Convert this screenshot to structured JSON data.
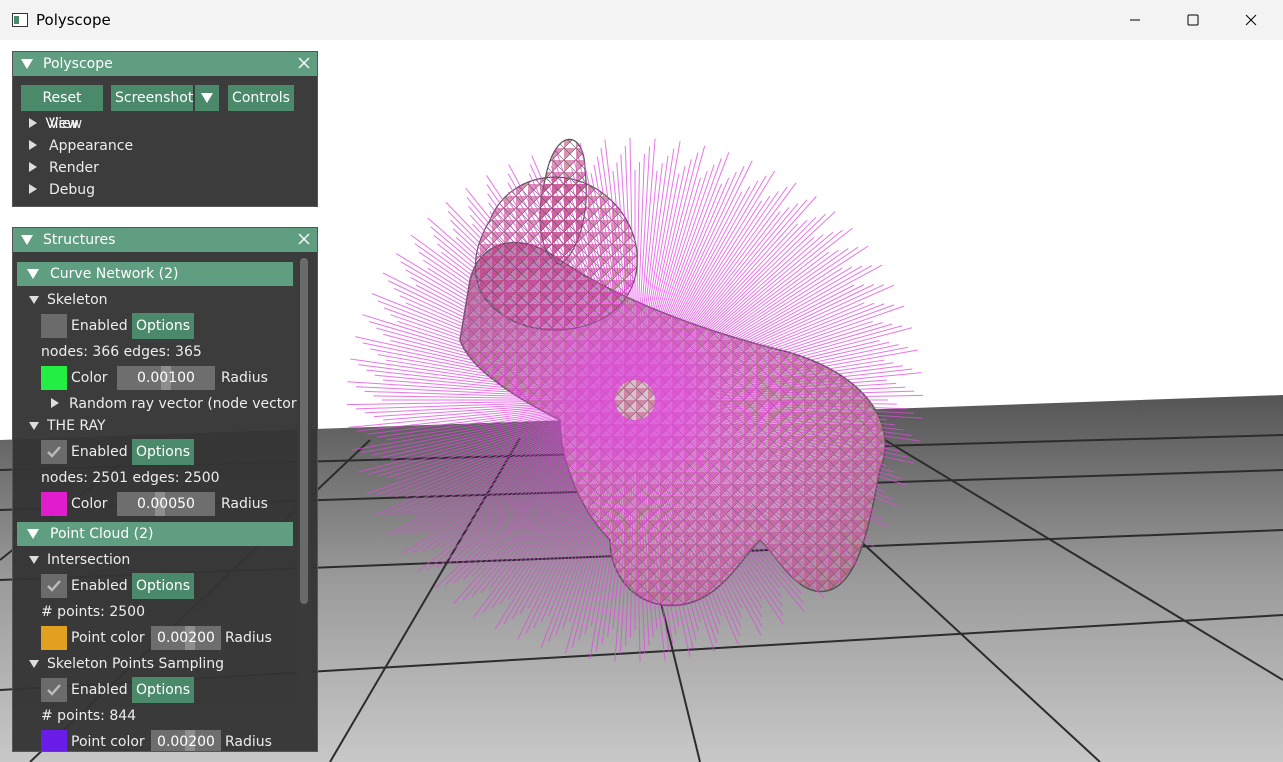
{
  "window": {
    "title": "Polyscope",
    "minimize_icon": "minimize-icon",
    "maximize_icon": "maximize-icon",
    "close_icon": "close-icon"
  },
  "colors": {
    "accent": "#5f9e80",
    "button": "#4a8a6a",
    "panel_bg": "#343434",
    "ray": "#e048e0"
  },
  "polyscope_panel": {
    "title": "Polyscope",
    "buttons": {
      "reset_view": "Reset View",
      "screenshot": "Screenshot",
      "controls": "Controls"
    },
    "menu": [
      "View",
      "Appearance",
      "Render",
      "Debug"
    ]
  },
  "structures_panel": {
    "title": "Structures",
    "curve_network": {
      "header": "Curve Network (2)",
      "skeleton": {
        "name": "Skeleton",
        "enabled_label": "Enabled",
        "options_label": "Options",
        "stats": "nodes: 366  edges: 365",
        "color_label": "Color",
        "color": "#22ee44",
        "radius_value": "0.00100",
        "radius_label": "Radius",
        "quantity": "Random ray vector (node vector)"
      },
      "the_ray": {
        "name": "THE RAY",
        "enabled_label": "Enabled",
        "options_label": "Options",
        "stats": "nodes: 2501  edges: 2500",
        "color_label": "Color",
        "color": "#e01ccc",
        "radius_value": "0.00050",
        "radius_label": "Radius"
      }
    },
    "point_cloud": {
      "header": "Point Cloud (2)",
      "intersection": {
        "name": "Intersection",
        "enabled_label": "Enabled",
        "options_label": "Options",
        "stats": "# points: 2500",
        "color_label": "Point color",
        "color": "#e2a020",
        "radius_value": "0.00200",
        "radius_label": "Radius"
      },
      "skeleton_points": {
        "name": "Skeleton Points Sampling",
        "enabled_label": "Enabled",
        "options_label": "Options",
        "stats": "# points: 844",
        "color_label": "Point color",
        "color": "#6a1ce8",
        "radius_value": "0.00200",
        "radius_label": "Radius"
      }
    }
  }
}
